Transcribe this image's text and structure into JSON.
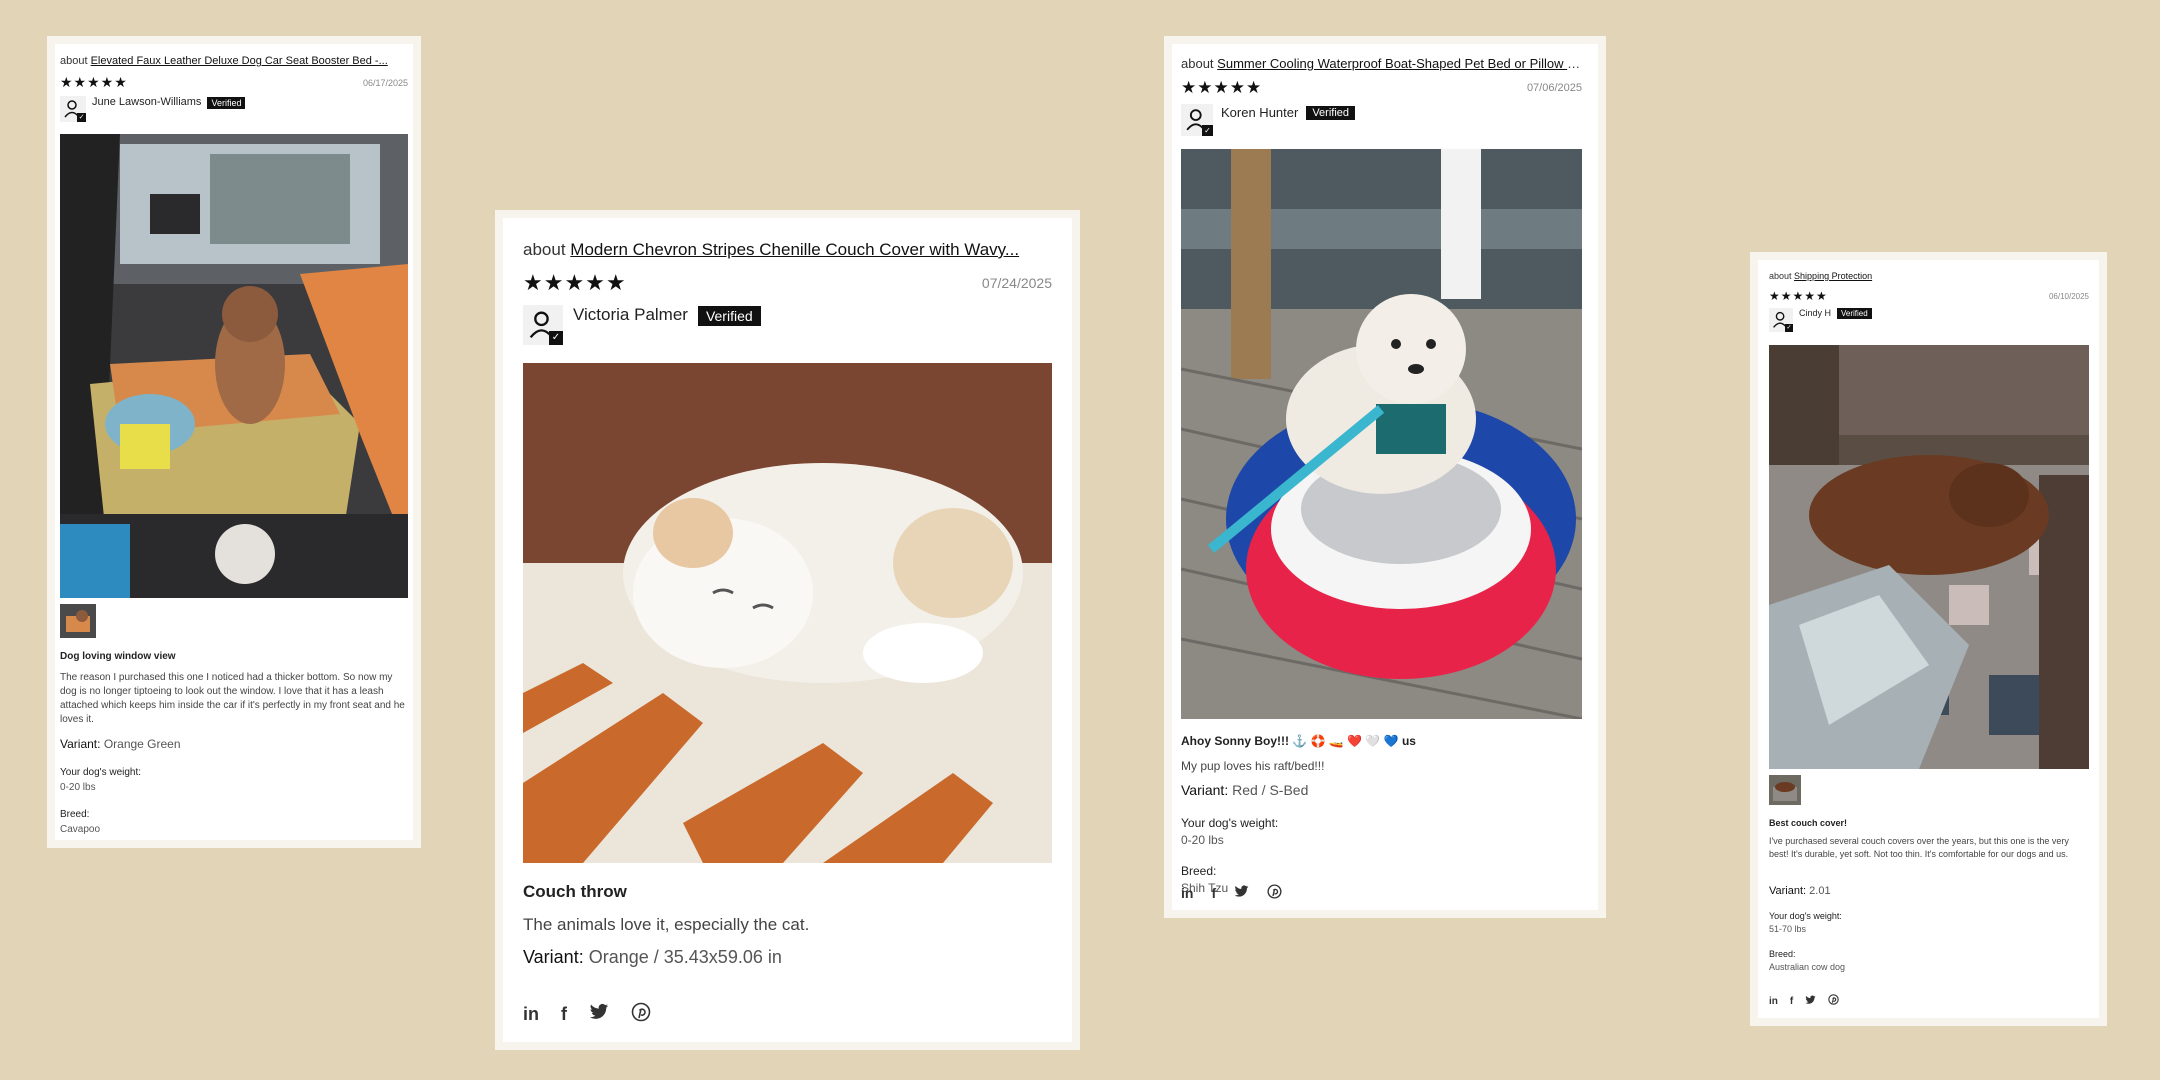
{
  "reviews": [
    {
      "about_prefix": "about",
      "product": "Elevated Faux Leather Deluxe Dog Car Seat Booster Bed -...",
      "stars": "★★★★★",
      "date": "06/17/2025",
      "author": "June Lawson-Williams",
      "verified": "Verified",
      "title": "Dog loving window view",
      "body": "The reason I purchased this one I noticed had a thicker bottom. So now my dog is no longer tiptoeing to look out the window. I love that it has a leash attached which keeps him inside the car if it's perfectly in my front seat and he loves it.",
      "variant_label": "Variant:",
      "variant_value": "Orange Green",
      "q1_label": "Your dog's weight:",
      "q1_value": "0-20 lbs",
      "q2_label": "Breed:",
      "q2_value": "Cavapoo"
    },
    {
      "about_prefix": "about",
      "product": "Modern Chevron Stripes Chenille Couch Cover with Wavy...",
      "stars": "★★★★★",
      "date": "07/24/2025",
      "author": "Victoria Palmer",
      "verified": "Verified",
      "title": "Couch throw",
      "body": "The animals love it, especially the cat.",
      "variant_label": "Variant:",
      "variant_value": "Orange / 35.43x59.06 in"
    },
    {
      "about_prefix": "about",
      "product": "Summer Cooling Waterproof Boat-Shaped Pet Bed or Pillow -...",
      "stars": "★★★★★",
      "date": "07/06/2025",
      "author": "Koren Hunter",
      "verified": "Verified",
      "title": "Ahoy Sonny Boy!!! ⚓ 🛟 🚤 ❤️ 🤍 💙 us",
      "body": "My pup loves his raft/bed!!!",
      "variant_label": "Variant:",
      "variant_value": "Red / S-Bed",
      "q1_label": "Your dog's weight:",
      "q1_value": "0-20 lbs",
      "q2_label": "Breed:",
      "q2_value": "Shih Tzu"
    },
    {
      "about_prefix": "about",
      "product": "Shipping Protection",
      "stars": "★★★★★",
      "date": "06/10/2025",
      "author": "Cindy H",
      "verified": "Verified",
      "title": "Best couch cover!",
      "body": "I've purchased several couch covers over the years, but this one is the very best! It's durable, yet soft. Not too thin. It's comfortable for our dogs and us.",
      "variant_label": "Variant:",
      "variant_value": "2.01",
      "q1_label": "Your dog's weight:",
      "q1_value": "51-70 lbs",
      "q2_label": "Breed:",
      "q2_value": "Australian cow dog"
    }
  ],
  "social": {
    "linkedin": "in",
    "facebook": "f",
    "twitter": "🐦",
    "pinterest": "℗"
  },
  "colors": {
    "background": "#e2d4b7",
    "card": "#ffffff",
    "verified_bg": "#111111"
  }
}
